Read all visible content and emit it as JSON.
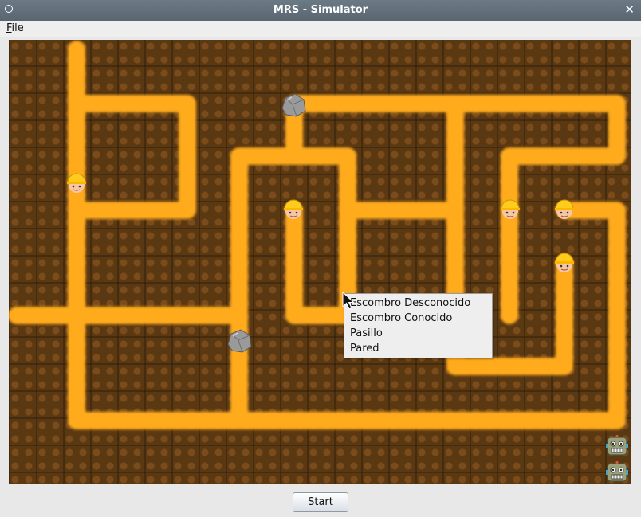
{
  "window": {
    "title": "MRS - Simulator",
    "close_glyph": "✕"
  },
  "menubar": {
    "file_first": "F",
    "file_rest": "ile"
  },
  "context_menu": [
    "Escombro Desconocido",
    "Escombro Conocido",
    "Pasillo",
    "Pared"
  ],
  "footer": {
    "start_label": "Start"
  },
  "colors": {
    "corridor": "#ffab1a",
    "ground": "#5a3812",
    "titlebar": "#606d78"
  },
  "legend_icons": {
    "worker": "worker-helmet-icon",
    "rubble": "rock-icon",
    "robot": "robot-icon"
  }
}
